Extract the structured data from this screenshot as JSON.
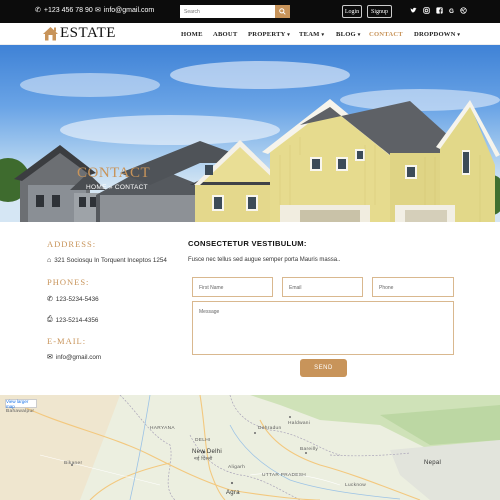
{
  "topbar": {
    "phone": "+123 456 78 90",
    "email": "info@gmail.com",
    "search_placeholder": "Search",
    "login_label": "Login",
    "signup_label": "Signup",
    "social": [
      "twitter-icon",
      "instagram-icon",
      "facebook-icon",
      "google-icon",
      "dribbble-icon"
    ]
  },
  "nav": {
    "logo": "ESTATE",
    "items": [
      "HOME",
      "ABOUT",
      "PROPERTY",
      "TEAM",
      "BLOG",
      "CONTACT",
      "DROPDOWN"
    ],
    "active": "CONTACT"
  },
  "hero": {
    "title": "CONTACT",
    "crumb_home": "HOME",
    "crumb_current": "CONTACT"
  },
  "contact": {
    "address_head": "ADDRESS:",
    "address": "321 Sociosqu In Torquent Inceptos 1254",
    "phones_head": "PHONES:",
    "phone1": "123-5234-5436",
    "phone2": "123-5214-4356",
    "email_head": "E-MAIL:",
    "email": "info@gmail.com"
  },
  "form": {
    "title": "CONSECTETUR VESTIBULUM:",
    "subtitle": "Fusce nec tellus sed augue semper porta Mauris massa..",
    "first_name": "First Name",
    "email": "Email",
    "phone": "Phone",
    "message": "Message",
    "send_label": "SEND"
  },
  "map": {
    "larger_map": "View larger map",
    "labels": {
      "bahawalpur": "Bahawalpur",
      "haryana": "HARYANA",
      "delhi": "DELHI",
      "new_delhi": "New Delhi",
      "new_delhi_hi": "नई दिल्ली",
      "uttar_pradesh": "UTTAR PRADESH",
      "agra": "Agra",
      "nepal": "Nepal",
      "bikaner": "Bikaner",
      "bareilly": "Bareilly",
      "aligarh": "Aligarh",
      "lucknow": "Lucknow",
      "dehradun": "Dehradun",
      "haldwani": "Haldwani"
    }
  },
  "colors": {
    "accent": "#c8945a",
    "topbar": "#0c0c0c"
  }
}
